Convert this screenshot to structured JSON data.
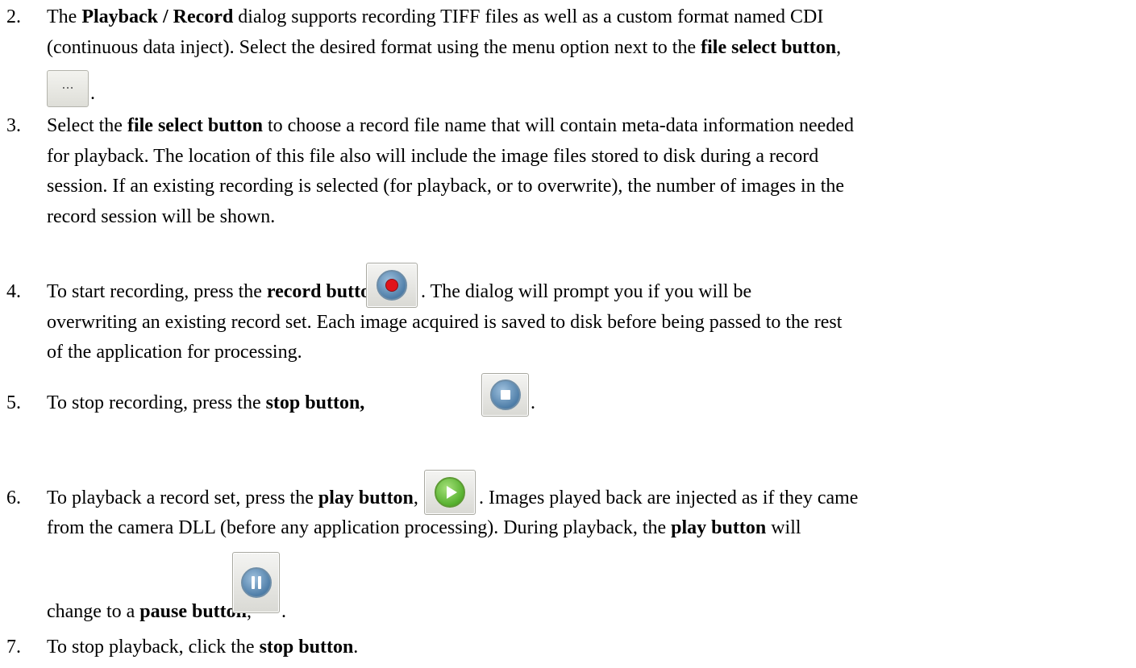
{
  "items": {
    "i2": {
      "num": "2.",
      "l1_a": "The ",
      "l1_b": "Playback / Record",
      "l1_c": " dialog supports recording TIFF files as well as a custom format named CDI",
      "l2_a": "(continuous data inject).  Select the desired format using the menu option next to the ",
      "l2_b": "file select button",
      "l2_c": ",",
      "l3": "."
    },
    "i3": {
      "num": "3.",
      "l1_a": "Select the ",
      "l1_b": "file select button",
      "l1_c": " to choose a record file name that will contain meta-data information needed",
      "l2": "for playback.  The location of this file also will include the image files stored to disk during a record",
      "l3": "session.  If an existing recording is selected (for playback, or to overwrite), the number of images in the",
      "l4": "record session will be shown."
    },
    "i4": {
      "num": "4.",
      "l1_a": "To start recording, press the ",
      "l1_b": "record button",
      "l1_c": ",",
      "l1_d": ".  The dialog will prompt you if you will be",
      "l2": "overwriting an existing record set.  Each image acquired is saved to disk before being passed to the rest",
      "l3": "of the application for processing."
    },
    "i5": {
      "num": "5.",
      "l1_a": "To stop recording, press the ",
      "l1_b": "stop button,",
      "l1_c": "."
    },
    "i6": {
      "num": "6.",
      "l1_a": "To playback a record set, press the ",
      "l1_b": "play button",
      "l1_c": ",",
      "l1_d": ".  Images played back are injected as if they came",
      "l2_a": "from the camera DLL (before any application processing).  During playback, the ",
      "l2_b": "play button",
      "l2_c": " will",
      "l3_a": "change to a ",
      "l3_b": "pause button",
      "l3_c": ",",
      "l3_d": "."
    },
    "i7": {
      "num": "7.",
      "l1_a": "To stop playback, click the ",
      "l1_b": "stop button",
      "l1_c": "."
    }
  },
  "icons": {
    "ellipsis_glyph": "...",
    "file_select": "ellipsis-icon",
    "record": "record-icon",
    "stop": "stop-icon",
    "play": "play-icon",
    "pause": "pause-icon"
  }
}
